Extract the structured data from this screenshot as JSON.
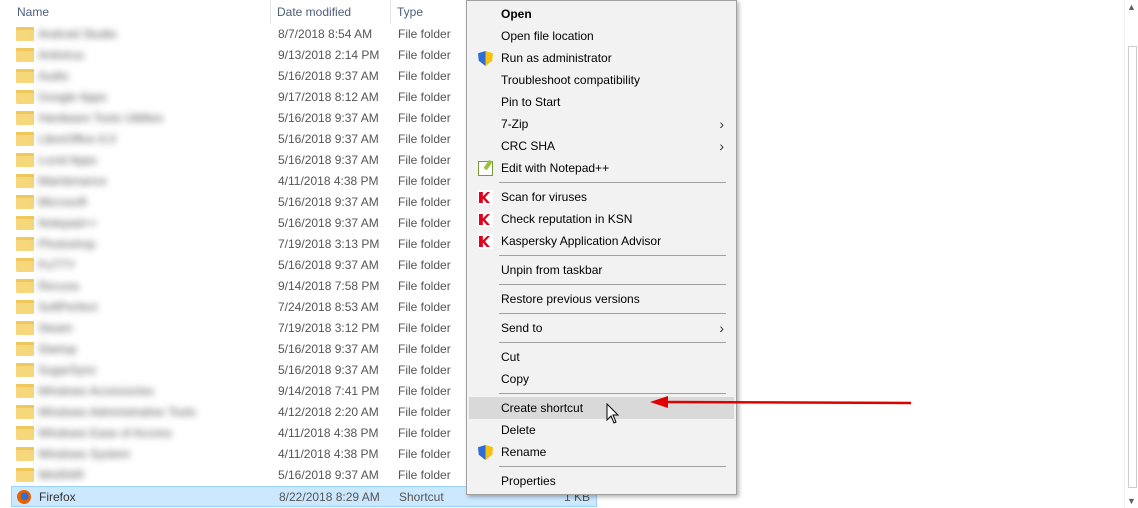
{
  "header": {
    "name_label": "Name",
    "date_label": "Date modified",
    "type_label": "Type",
    "sort_indicator": "^"
  },
  "rows": [
    {
      "name": "Android Studio",
      "date": "8/7/2018 8:54 AM",
      "type": "File folder"
    },
    {
      "name": "Antivirus",
      "date": "9/13/2018 2:14 PM",
      "type": "File folder"
    },
    {
      "name": "Audio",
      "date": "5/16/2018 9:37 AM",
      "type": "File folder"
    },
    {
      "name": "Google Apps",
      "date": "9/17/2018 8:12 AM",
      "type": "File folder"
    },
    {
      "name": "Hardware Tools Utilities",
      "date": "5/16/2018 9:37 AM",
      "type": "File folder"
    },
    {
      "name": "LibreOffice 6.0",
      "date": "5/16/2018 9:37 AM",
      "type": "File folder"
    },
    {
      "name": "Lucid Apps",
      "date": "5/16/2018 9:37 AM",
      "type": "File folder"
    },
    {
      "name": "Maintenance",
      "date": "4/11/2018 4:38 PM",
      "type": "File folder"
    },
    {
      "name": "Microsoft",
      "date": "5/16/2018 9:37 AM",
      "type": "File folder"
    },
    {
      "name": "Notepad++",
      "date": "5/16/2018 9:37 AM",
      "type": "File folder"
    },
    {
      "name": "Photoshop",
      "date": "7/19/2018 3:13 PM",
      "type": "File folder"
    },
    {
      "name": "PuTTY",
      "date": "5/16/2018 9:37 AM",
      "type": "File folder"
    },
    {
      "name": "Recuva",
      "date": "9/14/2018 7:58 PM",
      "type": "File folder"
    },
    {
      "name": "SoftPerfect",
      "date": "7/24/2018 8:53 AM",
      "type": "File folder"
    },
    {
      "name": "Steam",
      "date": "7/19/2018 3:12 PM",
      "type": "File folder"
    },
    {
      "name": "Startup",
      "date": "5/16/2018 9:37 AM",
      "type": "File folder"
    },
    {
      "name": "SugarSync",
      "date": "5/16/2018 9:37 AM",
      "type": "File folder"
    },
    {
      "name": "Windows Accessories",
      "date": "9/14/2018 7:41 PM",
      "type": "File folder"
    },
    {
      "name": "Windows Administrative Tools",
      "date": "4/12/2018 2:20 AM",
      "type": "File folder"
    },
    {
      "name": "Windows Ease of Access",
      "date": "4/11/2018 4:38 PM",
      "type": "File folder"
    },
    {
      "name": "Windows System",
      "date": "4/11/2018 4:38 PM",
      "type": "File folder"
    },
    {
      "name": "WinRAR",
      "date": "5/16/2018 9:37 AM",
      "type": "File folder"
    }
  ],
  "selected_row": {
    "name": "Firefox",
    "date": "8/22/2018 8:29 AM",
    "type": "Shortcut",
    "size": "1 KB"
  },
  "menu": {
    "open": "Open",
    "open_location": "Open file location",
    "run_admin": "Run as administrator",
    "troubleshoot": "Troubleshoot compatibility",
    "pin_start": "Pin to Start",
    "zip": "7-Zip",
    "crc": "CRC SHA",
    "notepad": "Edit with Notepad++",
    "scan": "Scan for viruses",
    "ksn": "Check reputation in KSN",
    "kaspersky": "Kaspersky Application Advisor",
    "unpin": "Unpin from taskbar",
    "restore": "Restore previous versions",
    "send_to": "Send to",
    "cut": "Cut",
    "copy": "Copy",
    "create_shortcut": "Create shortcut",
    "delete": "Delete",
    "rename": "Rename",
    "properties": "Properties",
    "submenu_glyph": "›"
  },
  "colors": {
    "selection_bg": "#cce8ff",
    "menu_bg": "#f2f2f2",
    "menu_hover": "#d9d9d9",
    "arrow": "#e00000"
  }
}
